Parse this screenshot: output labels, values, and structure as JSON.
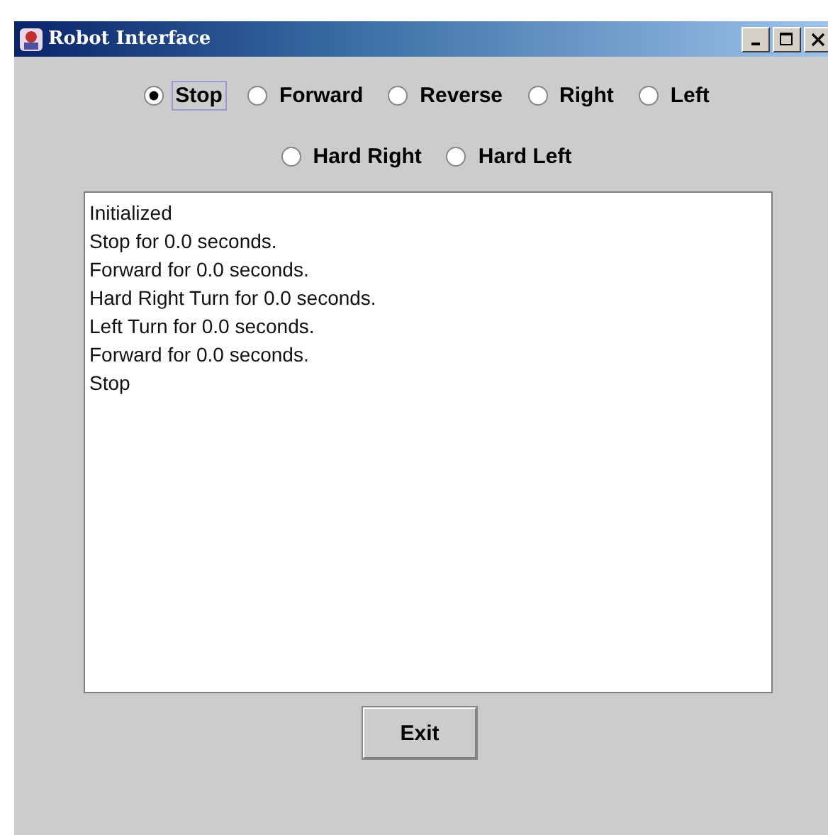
{
  "window": {
    "title": "Robot Interface"
  },
  "radio_rows": [
    [
      {
        "label": "Stop",
        "selected": true,
        "focused": true
      },
      {
        "label": "Forward",
        "selected": false,
        "focused": false
      },
      {
        "label": "Reverse",
        "selected": false,
        "focused": false
      },
      {
        "label": "Right",
        "selected": false,
        "focused": false
      },
      {
        "label": "Left",
        "selected": false,
        "focused": false
      }
    ],
    [
      {
        "label": "Hard Right",
        "selected": false,
        "focused": false
      },
      {
        "label": "Hard Left",
        "selected": false,
        "focused": false
      }
    ]
  ],
  "log_lines": [
    "Initialized",
    "Stop for 0.0 seconds.",
    "Forward for 0.0 seconds.",
    "Hard Right Turn for 0.0 seconds.",
    "Left Turn for 0.0 seconds.",
    "Forward for 0.0 seconds.",
    "Stop"
  ],
  "buttons": [
    "Exit"
  ]
}
